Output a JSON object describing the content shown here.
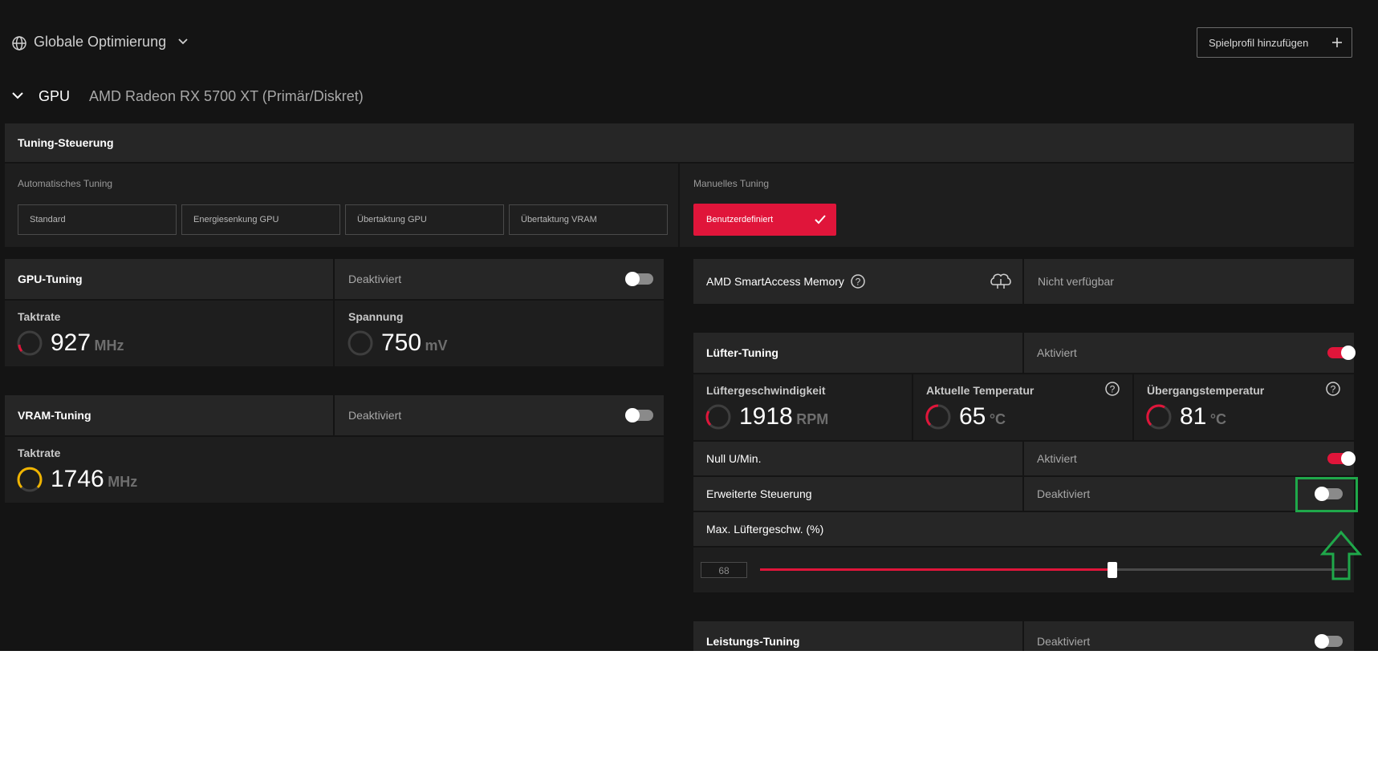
{
  "header": {
    "profile_label": "Globale Optimierung",
    "add_profile_label": "Spielprofil hinzufügen"
  },
  "gpu_row": {
    "label": "GPU",
    "name": "AMD Radeon RX 5700 XT (Primär/Diskret)"
  },
  "tuning_control": {
    "title": "Tuning-Steuerung",
    "auto_label": "Automatisches Tuning",
    "auto_options": [
      "Standard",
      "Energiesenkung GPU",
      "Übertaktung GPU",
      "Übertaktung VRAM"
    ],
    "manual_label": "Manuelles Tuning",
    "manual_option": "Benutzerdefiniert"
  },
  "gpu_tuning": {
    "title": "GPU-Tuning",
    "status": "Deaktiviert",
    "enabled": false,
    "clock_label": "Taktrate",
    "clock_value": "927",
    "clock_unit": "MHz",
    "voltage_label": "Spannung",
    "voltage_value": "750",
    "voltage_unit": "mV"
  },
  "vram_tuning": {
    "title": "VRAM-Tuning",
    "status": "Deaktiviert",
    "enabled": false,
    "clock_label": "Taktrate",
    "clock_value": "1746",
    "clock_unit": "MHz"
  },
  "smart_access": {
    "label": "AMD SmartAccess Memory",
    "status": "Nicht verfügbar"
  },
  "fan_tuning": {
    "title": "Lüfter-Tuning",
    "status": "Aktiviert",
    "enabled": true,
    "speed_label": "Lüftergeschwindigkeit",
    "speed_value": "1918",
    "speed_unit": "RPM",
    "temp_label": "Aktuelle Temperatur",
    "temp_value": "65",
    "temp_unit": "°C",
    "junction_label": "Übergangstemperatur",
    "junction_value": "81",
    "junction_unit": "°C",
    "zero_rpm_label": "Null U/Min.",
    "zero_rpm_status": "Aktiviert",
    "zero_rpm_enabled": true,
    "advanced_label": "Erweiterte Steuerung",
    "advanced_status": "Deaktiviert",
    "advanced_enabled": false,
    "max_speed_label": "Max. Lüftergeschw. (%)",
    "max_speed_value": "68",
    "max_speed_percent": 68
  },
  "power_tuning": {
    "title": "Leistungs-Tuning",
    "status": "Deaktiviert",
    "enabled": false
  },
  "colors": {
    "accent_red": "#e0153a",
    "highlight_green": "#1fa84a",
    "gauge_yellow": "#f0b400",
    "background": "#141414",
    "panel": "#262626"
  }
}
